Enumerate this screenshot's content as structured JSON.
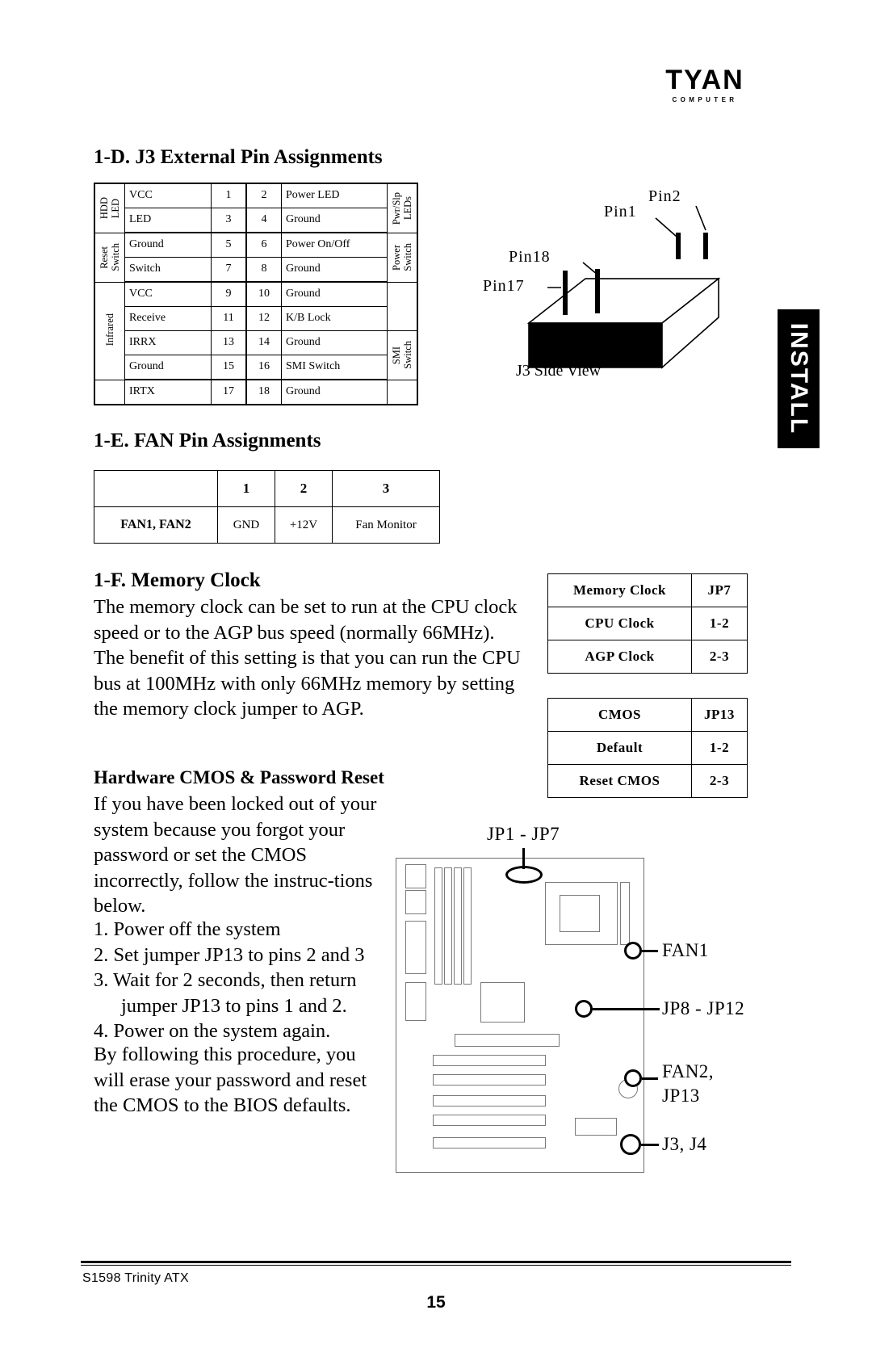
{
  "brand": {
    "logo_text": "TYAN",
    "logo_subtext": "COMPUTER"
  },
  "side_tab": {
    "label": "INSTALL"
  },
  "sections": {
    "j3": {
      "heading": "1-D.  J3 External Pin Assignments",
      "table": {
        "rows": [
          {
            "left_group": [
              "HDD",
              "LED"
            ],
            "name": "VCC",
            "pin_left": "1",
            "pin_right": "2",
            "function": "Power LED",
            "right_group": [
              "Pwr/Slp",
              "LEDs"
            ]
          },
          {
            "left_group": [],
            "name": "LED",
            "pin_left": "3",
            "pin_right": "4",
            "function": "Ground",
            "right_group": []
          },
          {
            "left_group": [
              "Reset",
              "Switch"
            ],
            "name": "Ground",
            "pin_left": "5",
            "pin_right": "6",
            "function": "Power On/Off",
            "right_group": [
              "Power",
              "Switch"
            ]
          },
          {
            "left_group": [],
            "name": "Switch",
            "pin_left": "7",
            "pin_right": "8",
            "function": "Ground",
            "right_group": []
          },
          {
            "left_group": [
              "Infrared"
            ],
            "name": "VCC",
            "pin_left": "9",
            "pin_right": "10",
            "function": "Ground",
            "right_group": []
          },
          {
            "left_group": [],
            "name": "Receive",
            "pin_left": "11",
            "pin_right": "12",
            "function": "K/B Lock",
            "right_group": []
          },
          {
            "left_group": [],
            "name": "IRRX",
            "pin_left": "13",
            "pin_right": "14",
            "function": "Ground",
            "right_group": [
              "SMI",
              "Switch"
            ]
          },
          {
            "left_group": [],
            "name": "Ground",
            "pin_left": "15",
            "pin_right": "16",
            "function": "SMI Switch",
            "right_group": []
          },
          {
            "left_group": [],
            "name": "IRTX",
            "pin_left": "17",
            "pin_right": "18",
            "function": "Ground",
            "right_group": []
          }
        ]
      },
      "diagram": {
        "caption": "J3 Side View",
        "labels": {
          "pin1": "Pin1",
          "pin2": "Pin2",
          "pin17": "Pin17",
          "pin18": "Pin18"
        }
      }
    },
    "fan": {
      "heading": "1-E.  FAN Pin Assignments",
      "table": {
        "header": [
          "",
          "1",
          "2",
          "3"
        ],
        "rows": [
          [
            "FAN1, FAN2",
            "GND",
            "+12V",
            "Fan Monitor"
          ]
        ]
      }
    },
    "memory_clock": {
      "heading": "1-F. Memory Clock",
      "paragraph": "The memory clock can be set to run at the CPU clock speed or to the AGP bus speed (normally 66MHz). The benefit of this setting is that you can run the CPU bus at 100MHz with only 66MHz memory by setting the memory clock jumper to AGP.",
      "table": {
        "header": [
          "Memory Clock",
          "JP7"
        ],
        "rows": [
          [
            "CPU Clock",
            "1-2"
          ],
          [
            "AGP Clock",
            "2-3"
          ]
        ]
      }
    },
    "cmos_reset": {
      "heading": "Hardware CMOS & Password Reset",
      "paragraph": "If you have been locked out of your system because you forgot your password or set the CMOS incorrectly, follow the instruc-tions below.",
      "steps": [
        "1. Power off the system",
        "2. Set jumper JP13 to pins 2 and 3",
        "3. Wait for 2 seconds, then return jumper JP13 to pins 1 and 2.",
        "4. Power on the system again."
      ],
      "closing": "By following this procedure, you will erase your password and reset the CMOS to the BIOS defaults.",
      "table": {
        "header": [
          "CMOS",
          "JP13"
        ],
        "rows": [
          [
            "Default",
            "1-2"
          ],
          [
            "Reset CMOS",
            "2-3"
          ]
        ]
      },
      "board_diagram": {
        "labels": {
          "jp1_jp7": "JP1 - JP7",
          "fan1": "FAN1",
          "jp8_jp12": "JP8 - JP12",
          "fan2_jp13_line1": "FAN2,",
          "fan2_jp13_line2": "JP13",
          "j3_j4": "J3, J4"
        }
      }
    }
  },
  "footer": {
    "model": "S1598  Trinity ATX",
    "page_number": "15"
  }
}
